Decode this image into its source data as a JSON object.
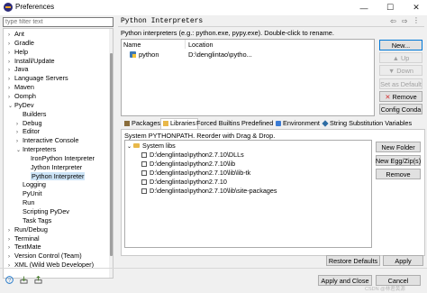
{
  "window": {
    "title": "Preferences",
    "minimize": "—",
    "maximize": "☐",
    "close": "✕"
  },
  "filter": {
    "placeholder": "type filter text"
  },
  "tree": [
    {
      "label": "Ant",
      "indent": 0,
      "toggle": "›",
      "selected": false
    },
    {
      "label": "Gradle",
      "indent": 0,
      "toggle": "›",
      "selected": false
    },
    {
      "label": "Help",
      "indent": 0,
      "toggle": "›",
      "selected": false
    },
    {
      "label": "Install/Update",
      "indent": 0,
      "toggle": "›",
      "selected": false
    },
    {
      "label": "Java",
      "indent": 0,
      "toggle": "›",
      "selected": false
    },
    {
      "label": "Language Servers",
      "indent": 0,
      "toggle": "›",
      "selected": false
    },
    {
      "label": "Maven",
      "indent": 0,
      "toggle": "›",
      "selected": false
    },
    {
      "label": "Oomph",
      "indent": 0,
      "toggle": "›",
      "selected": false
    },
    {
      "label": "PyDev",
      "indent": 0,
      "toggle": "⌄",
      "selected": false
    },
    {
      "label": "Builders",
      "indent": 1,
      "toggle": "",
      "selected": false
    },
    {
      "label": "Debug",
      "indent": 1,
      "toggle": "›",
      "selected": false
    },
    {
      "label": "Editor",
      "indent": 1,
      "toggle": "›",
      "selected": false
    },
    {
      "label": "Interactive Console",
      "indent": 1,
      "toggle": "›",
      "selected": false
    },
    {
      "label": "Interpreters",
      "indent": 1,
      "toggle": "⌄",
      "selected": false
    },
    {
      "label": "IronPython Interpreter",
      "indent": 2,
      "toggle": "",
      "selected": false
    },
    {
      "label": "Jython Interpreter",
      "indent": 2,
      "toggle": "",
      "selected": false
    },
    {
      "label": "Python Interpreter",
      "indent": 2,
      "toggle": "",
      "selected": true
    },
    {
      "label": "Logging",
      "indent": 1,
      "toggle": "",
      "selected": false
    },
    {
      "label": "PyUnit",
      "indent": 1,
      "toggle": "",
      "selected": false
    },
    {
      "label": "Run",
      "indent": 1,
      "toggle": "",
      "selected": false
    },
    {
      "label": "Scripting PyDev",
      "indent": 1,
      "toggle": "",
      "selected": false
    },
    {
      "label": "Task Tags",
      "indent": 1,
      "toggle": "",
      "selected": false
    },
    {
      "label": "Run/Debug",
      "indent": 0,
      "toggle": "›",
      "selected": false
    },
    {
      "label": "Terminal",
      "indent": 0,
      "toggle": "›",
      "selected": false
    },
    {
      "label": "TextMate",
      "indent": 0,
      "toggle": "›",
      "selected": false
    },
    {
      "label": "Version Control (Team)",
      "indent": 0,
      "toggle": "›",
      "selected": false
    },
    {
      "label": "XML (Wild Web Developer)",
      "indent": 0,
      "toggle": "›",
      "selected": false
    }
  ],
  "page": {
    "title": "Python Interpreters",
    "back": "⇦",
    "forward": "⇨",
    "menu": "⋮",
    "description": "Python interpreters (e.g.: python.exe, pypy.exe).   Double-click to rename."
  },
  "interpreters": {
    "col_name": "Name",
    "col_location": "Location",
    "rows": [
      {
        "name": "python",
        "location": "D:\\denglintao\\pytho..."
      }
    ]
  },
  "buttons": {
    "new": "New...",
    "up": "Up",
    "down": "Down",
    "set_default": "Set as Default",
    "remove": "Remove",
    "config_conda": "Config Conda",
    "new_folder": "New Folder",
    "new_egg_zip": "New Egg/Zip(s)",
    "remove_lib": "Remove",
    "restore_defaults": "Restore Defaults",
    "apply": "Apply",
    "apply_and_close": "Apply and Close",
    "cancel": "Cancel"
  },
  "tabs": [
    "Packages",
    "Libraries",
    "Forced Builtins",
    "Predefined",
    "Environment",
    "String Substitution Variables"
  ],
  "libraries": {
    "description": "System PYTHONPATH.   Reorder with Drag & Drop.",
    "root": "System libs",
    "items": [
      "D:\\denglintao\\python2.7.10\\DLLs",
      "D:\\denglintao\\python2.7.10\\lib",
      "D:\\denglintao\\python2.7.10\\lib\\lib-tk",
      "D:\\denglintao\\python2.7.10",
      "D:\\denglintao\\python2.7.10\\lib\\site-packages"
    ]
  },
  "watermark": "CSDN @林君黄源",
  "colors": {
    "selection": "#cce4f7",
    "default_button_border": "#0078d7",
    "remove_icon": "#d32f2f"
  }
}
